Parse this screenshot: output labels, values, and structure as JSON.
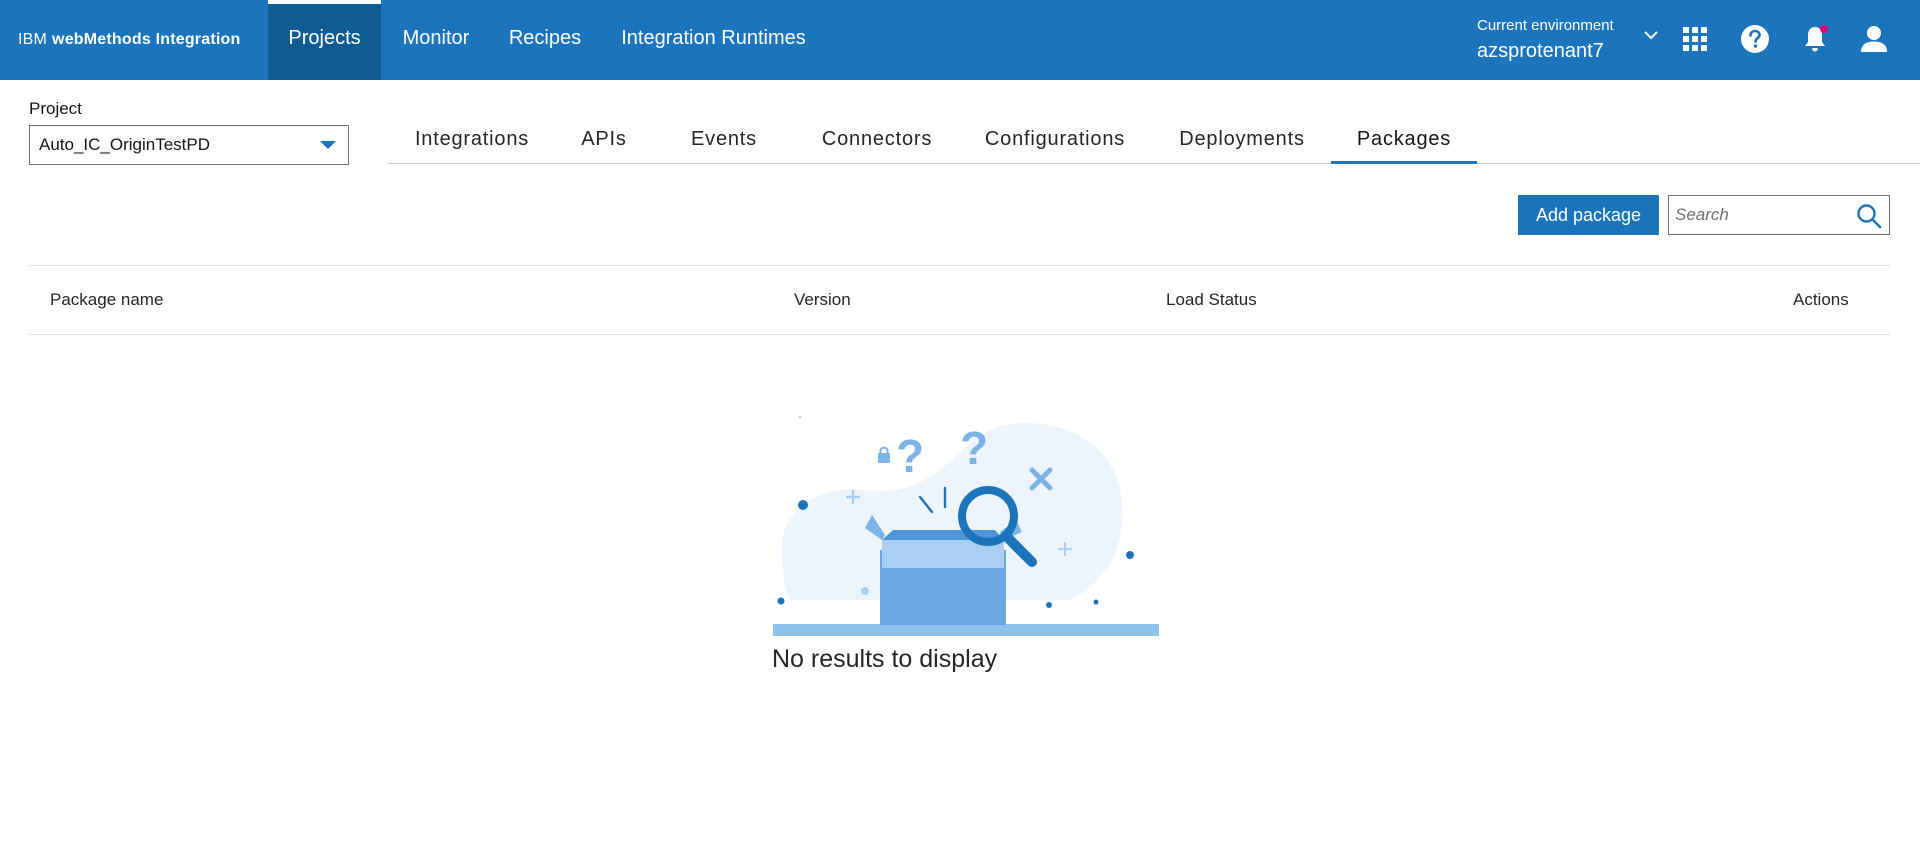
{
  "header": {
    "brand_prefix": "IBM",
    "brand_name": "webMethods Integration",
    "nav": [
      {
        "label": "Projects",
        "active": true
      },
      {
        "label": "Monitor",
        "active": false
      },
      {
        "label": "Recipes",
        "active": false
      },
      {
        "label": "Integration Runtimes",
        "active": false
      }
    ],
    "environment_label": "Current environment",
    "environment_value": "azsprotenant7",
    "icons": [
      "chevron-down-icon",
      "app-switcher-icon",
      "help-icon",
      "notification-icon",
      "user-icon"
    ],
    "notification_dot_color": "#e5007d"
  },
  "project": {
    "label": "Project",
    "selected": "Auto_IC_OriginTestPD"
  },
  "tabs": [
    {
      "label": "Integrations",
      "active": false
    },
    {
      "label": "APIs",
      "active": false
    },
    {
      "label": "Events",
      "active": false
    },
    {
      "label": "Connectors",
      "active": false
    },
    {
      "label": "Configurations",
      "active": false
    },
    {
      "label": "Deployments",
      "active": false
    },
    {
      "label": "Packages",
      "active": true
    }
  ],
  "toolbar": {
    "add_label": "Add package",
    "search_placeholder": "Search"
  },
  "table": {
    "columns": [
      "Package name",
      "Version",
      "Load Status",
      "Actions"
    ],
    "rows": []
  },
  "empty_state": {
    "message": "No results to display"
  },
  "colors": {
    "primary": "#1c75bc",
    "nav_active": "#0f5b92"
  }
}
